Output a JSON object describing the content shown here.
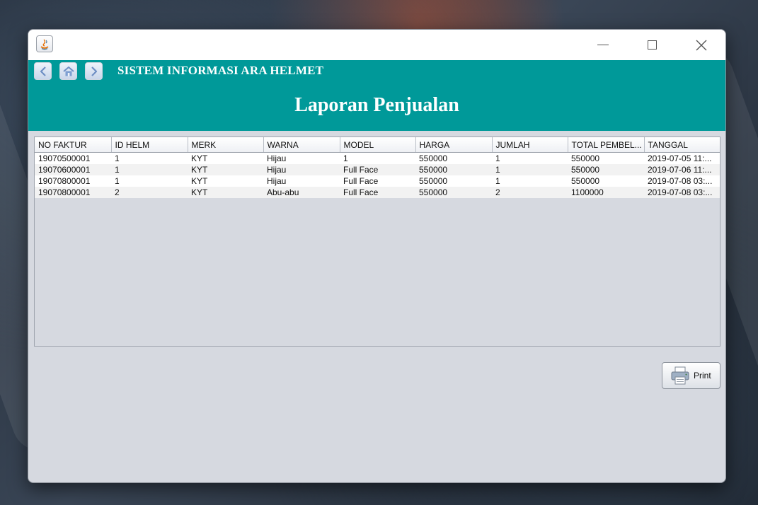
{
  "app": {
    "header_title": "SISTEM INFORMASI ARA HELMET",
    "page_title": "Laporan Penjualan"
  },
  "nav": {
    "back_icon": "arrow-left-icon",
    "home_icon": "home-icon",
    "forward_icon": "arrow-right-icon"
  },
  "window_controls": [
    "minimize",
    "maximize",
    "close"
  ],
  "table": {
    "columns": [
      "NO FAKTUR",
      "ID HELM",
      "MERK",
      "WARNA",
      "MODEL",
      "HARGA",
      "JUMLAH",
      "TOTAL PEMBEL...",
      "TANGGAL"
    ],
    "rows": [
      [
        "19070500001",
        "1",
        "KYT",
        "Hijau",
        "1",
        "550000",
        "1",
        "550000",
        "2019-07-05 11:..."
      ],
      [
        "19070600001",
        "1",
        "KYT",
        "Hijau",
        "Full Face",
        "550000",
        "1",
        "550000",
        "2019-07-06 11:..."
      ],
      [
        "19070800001",
        "1",
        "KYT",
        "Hijau",
        "Full Face",
        "550000",
        "1",
        "550000",
        "2019-07-08 03:..."
      ],
      [
        "19070800001",
        "2",
        "KYT",
        "Abu-abu",
        "Full Face",
        "550000",
        "2",
        "1100000",
        "2019-07-08 03:..."
      ]
    ]
  },
  "print_button": {
    "label": "Print",
    "icon": "printer-icon"
  },
  "colors": {
    "header": "#009999",
    "body": "#d6d9e0"
  }
}
